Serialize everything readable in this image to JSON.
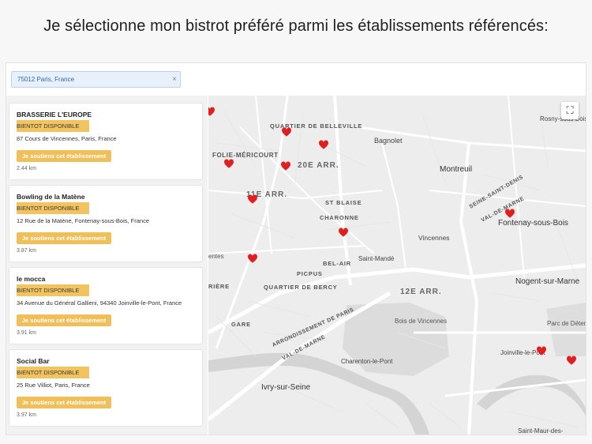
{
  "heading": "Je sélectionne mon bistrot préféré parmi les établissements référencés:",
  "search": {
    "value": "75012 Paris, France",
    "clear": "×"
  },
  "places": [
    {
      "name": "BRASSERIE L'EUROPE",
      "badge": "BIENTOT DISPONIBLE",
      "address": "87 Cours de Vincennes, Paris, France",
      "button": "Je soutiens cet établissement",
      "distance": "2.44 km"
    },
    {
      "name": "Bowling de la Matène",
      "badge": "BIENTOT DISPONIBLE",
      "address": "12 Rue de la Matène, Fontenay-sous-Bois, France",
      "button": "Je soutiens cet établissement",
      "distance": "3.87 km"
    },
    {
      "name": "le mocca",
      "badge": "BIENTOT DISPONIBLE",
      "address": "34 Avenue du Général Gallieni, 94340 Joinville-le-Pont, France",
      "button": "Je soutiens cet établissement",
      "distance": "3.91 km"
    },
    {
      "name": "Social Bar",
      "badge": "BIENTOT DISPONIBLE",
      "address": "25 Rue Villiot, Paris, France",
      "button": "Je soutiens cet établissement",
      "distance": "3.97 km"
    }
  ],
  "map": {
    "fullscreen_icon": "fullscreen-icon",
    "marker_icon": "heart-icon",
    "marker_color": "#e02020",
    "labels": {
      "quartier_belleville": "QUARTIER DE BELLEVILLE",
      "folie": "FOLIE-MÉRICOURT",
      "arr20": "20E ARR.",
      "arr11": "11E ARR.",
      "st_blaise": "ST BLAISE",
      "charonne": "CHARONNE",
      "bagnolet": "Bagnolet",
      "montreuil": "Montreuil",
      "rosny": "Rosny-sous-Bois",
      "fontenay": "Fontenay-sous-Bois",
      "val_de_marne": "VAL-DE-MARNE",
      "seine_st_denis": "SEINE-SAINT-DENIS",
      "vincennes": "Vincennes",
      "saint_mande": "Saint-Mandé",
      "bel_air": "BEL-AIR",
      "picpus": "PICPUS",
      "quartier_bercy": "QUARTIER DE BERCY",
      "arr12": "12E ARR.",
      "bois_vincennes": "Bois de Vincennes",
      "nogent": "Nogent-sur-Marne",
      "parc": "Parc de Détente et de Loisirs du Tremblay",
      "joinville": "Joinville-le-Pont",
      "charenton": "Charenton-le-Pont",
      "ivry": "Ivry-sur-Seine",
      "arrondissement": "ARRONDISSEMENT DE PARIS",
      "val_de_marne2": "VAL-DE-MARNE",
      "gare": "GARE",
      "riere": "RIÈRE",
      "entes": "entes",
      "saint_maur": "Saint-Maur-des-"
    }
  }
}
